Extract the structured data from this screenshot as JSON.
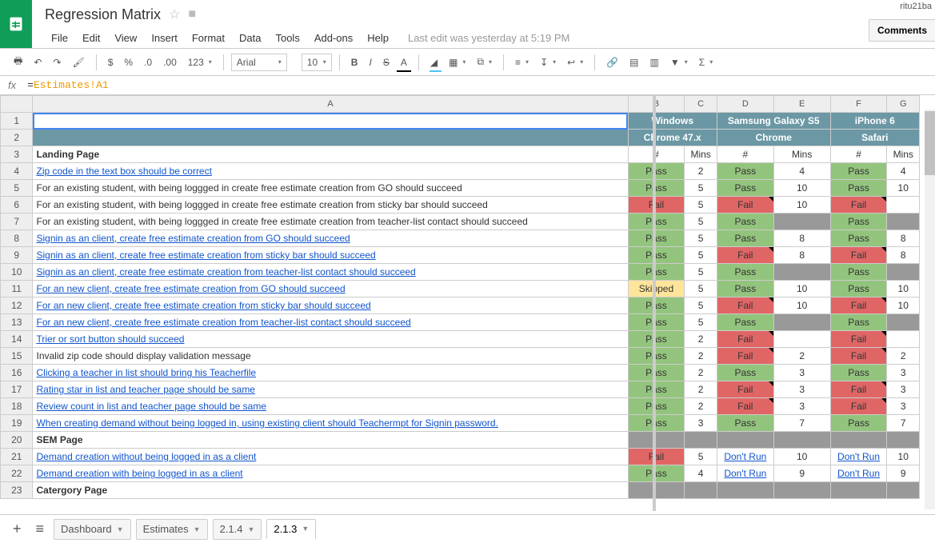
{
  "user": "ritu21ba",
  "doc": {
    "title": "Regression Matrix"
  },
  "menu": [
    "File",
    "Edit",
    "View",
    "Insert",
    "Format",
    "Data",
    "Tools",
    "Add-ons",
    "Help"
  ],
  "last_edit": "Last edit was yesterday at 5:19 PM",
  "comments_btn": "Comments",
  "toolbar": {
    "font": "Arial",
    "size": "10"
  },
  "formula": {
    "prefix": "=",
    "ref": "Estimates!A1"
  },
  "col_headers": [
    "A",
    "B",
    "C",
    "D",
    "E",
    "F",
    "G"
  ],
  "env_headers": {
    "b": "Windows",
    "de": "Samsung Galaxy S5",
    "f": "iPhone 6"
  },
  "browser_headers": {
    "bc": "Chrome 47.x",
    "de": "Chrome",
    "fg": "Safari"
  },
  "sub_headers": {
    "hash": "#",
    "mins": "Mins"
  },
  "rows": [
    {
      "n": 3,
      "a": "Landing Page",
      "bold": true
    },
    {
      "n": 4,
      "a": "Zip code in the text box should be correct",
      "link": true,
      "b": "Pass",
      "c": "2",
      "d": "Pass",
      "e": "4",
      "f": "Pass",
      "g": "4"
    },
    {
      "n": 5,
      "a": "For an existing student, with being loggged in create free estimate creation from GO should succeed",
      "b": "Pass",
      "c": "5",
      "d": "Pass",
      "e": "10",
      "f": "Pass",
      "g": "10"
    },
    {
      "n": 6,
      "a": "For an existing student, with being loggged in create free estimate creation from sticky bar should succeed",
      "b": "Fail",
      "c": "5",
      "d": "Fail",
      "e": "10",
      "f": "Fail",
      "g": "",
      "note_d": true,
      "note_f": true
    },
    {
      "n": 7,
      "a": "For an existing student, with being loggged in create free estimate creation from teacher-list contact should succeed",
      "b": "Pass",
      "c": "5",
      "d": "Pass",
      "e": "",
      "f": "Pass",
      "g": "",
      "grey_e": true,
      "grey_g": true
    },
    {
      "n": 8,
      "a": "Signin as an client, create free estimate creation from GO should succeed",
      "link": true,
      "b": "Pass",
      "c": "5",
      "d": "Pass",
      "e": "8",
      "f": "Pass",
      "g": "8"
    },
    {
      "n": 9,
      "a": "Signin as an client, create free estimate creation from sticky bar should succeed",
      "link": true,
      "b": "Pass",
      "c": "5",
      "d": "Fail",
      "e": "8",
      "f": "Fail",
      "g": "8",
      "note_d": true,
      "note_f": true
    },
    {
      "n": 10,
      "a": "Signin as an client, create free estimate creation from teacher-list contact should succeed",
      "link": true,
      "b": "Pass",
      "c": "5",
      "d": "Pass",
      "e": "",
      "f": "Pass",
      "g": "",
      "grey_e": true,
      "grey_g": true
    },
    {
      "n": 11,
      "a": "For an new  client, create free estimate creation from GO should succeed",
      "link": true,
      "b": "Skipped",
      "c": "5",
      "d": "Pass",
      "e": "10",
      "f": "Pass",
      "g": "10",
      "bstatus": "skip"
    },
    {
      "n": 12,
      "a": "For an new  client, create free estimate creation from sticky bar should succeed",
      "link": true,
      "b": "Pass",
      "c": "5",
      "d": "Fail",
      "e": "10",
      "f": "Fail",
      "g": "10",
      "note_d": true,
      "note_f": true
    },
    {
      "n": 13,
      "a": "For an new  client, create free estimate creation from teacher-list contact should succeed",
      "link": true,
      "b": "Pass",
      "c": "5",
      "d": "Pass",
      "e": "",
      "f": "Pass",
      "g": "",
      "grey_e": true,
      "grey_g": true
    },
    {
      "n": 14,
      "a": "Trier or sort button should succeed",
      "link": true,
      "b": "Pass",
      "c": "2",
      "d": "Fail",
      "e": "",
      "f": "Fail",
      "g": "",
      "note_d": true,
      "note_f": true
    },
    {
      "n": 15,
      "a": "Invalid zip code should display validation message",
      "b": "Pass",
      "c": "2",
      "d": "Fail",
      "e": "2",
      "f": "Fail",
      "g": "2",
      "note_d": true,
      "note_f": true
    },
    {
      "n": 16,
      "a": "Clicking a teacher in list should bring his Teacherfile",
      "link": true,
      "b": "Pass",
      "c": "2",
      "d": "Pass",
      "e": "3",
      "f": "Pass",
      "g": "3"
    },
    {
      "n": 17,
      "a": "Rating star in list and teacher page should be same",
      "link": true,
      "b": "Pass",
      "c": "2",
      "d": "Fail",
      "e": "3",
      "f": "Fail",
      "g": "3",
      "note_d": true,
      "note_f": true
    },
    {
      "n": 18,
      "a": "Review count in list and teacher page should be same",
      "link": true,
      "b": "Pass",
      "c": "2",
      "d": "Fail",
      "e": "3",
      "f": "Fail",
      "g": "3",
      "note_d": true,
      "note_f": true
    },
    {
      "n": 19,
      "a": "When creating demand without being logged in, using existing client should Teachermpt for Signin password.",
      "link": true,
      "b": "Pass",
      "c": "3",
      "d": "Pass",
      "e": "7",
      "f": "Pass",
      "g": "7"
    },
    {
      "n": 20,
      "a": "SEM Page",
      "bold": true,
      "greyrow": true
    },
    {
      "n": 21,
      "a": "Demand creation without being logged in as a client",
      "link": true,
      "b": "Fail",
      "c": "5",
      "d": "Don't Run",
      "e": "10",
      "f": "Don't Run",
      "g": "10"
    },
    {
      "n": 22,
      "a": "Demand creation with being logged in as a client",
      "link": true,
      "b": "Pass",
      "c": "4",
      "d": "Don't Run",
      "e": "9",
      "f": "Don't Run",
      "g": "9"
    },
    {
      "n": 23,
      "a": "Catergory Page",
      "bold": true,
      "greyrow": true
    }
  ],
  "tabs": [
    {
      "label": "Dashboard"
    },
    {
      "label": "Estimates"
    },
    {
      "label": "2.1.4"
    },
    {
      "label": "2.1.3",
      "active": true
    }
  ]
}
